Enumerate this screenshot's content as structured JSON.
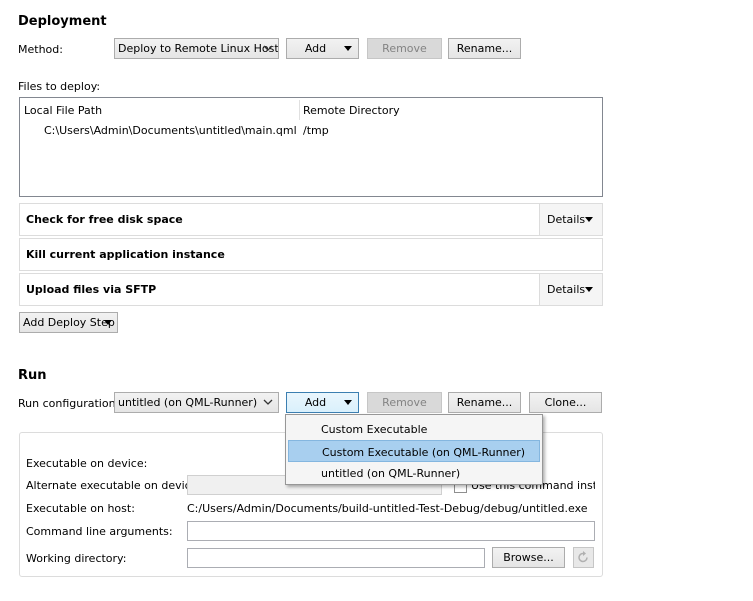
{
  "deployment": {
    "title": "Deployment",
    "method_label": "Method:",
    "method_value": "Deploy to Remote Linux Host",
    "add_label": "Add",
    "remove_label": "Remove",
    "rename_label": "Rename...",
    "files_label": "Files to deploy:",
    "table": {
      "columns": [
        "Local File Path",
        "Remote Directory"
      ],
      "rows": [
        {
          "local": "C:\\Users\\Admin\\Documents\\untitled\\main.qml",
          "remote": "/tmp"
        }
      ]
    },
    "steps": [
      {
        "title": "Check for free disk space",
        "details": "Details"
      },
      {
        "title": "Kill current application instance"
      },
      {
        "title": "Upload files via SFTP",
        "details": "Details"
      }
    ],
    "add_step_label": "Add Deploy Step"
  },
  "run": {
    "title": "Run",
    "config_label": "Run configuration:",
    "config_value": "untitled (on QML-Runner)",
    "add_label": "Add",
    "remove_label": "Remove",
    "rename_label": "Rename...",
    "clone_label": "Clone...",
    "fields": {
      "exec_device_label": "Executable on device:",
      "alt_exec_label": "Alternate executable on device:",
      "use_command_label": "Use this command instead",
      "exec_host_label": "Executable on host:",
      "exec_host_value": "C:/Users/Admin/Documents/build-untitled-Test-Debug/debug/untitled.exe",
      "cmd_args_label": "Command line arguments:",
      "working_dir_label": "Working directory:",
      "browse_label": "Browse..."
    },
    "add_menu": {
      "items": [
        "Custom Executable",
        "Custom Executable (on QML-Runner)",
        "untitled (on QML-Runner)"
      ],
      "highlighted_index": 1
    }
  }
}
